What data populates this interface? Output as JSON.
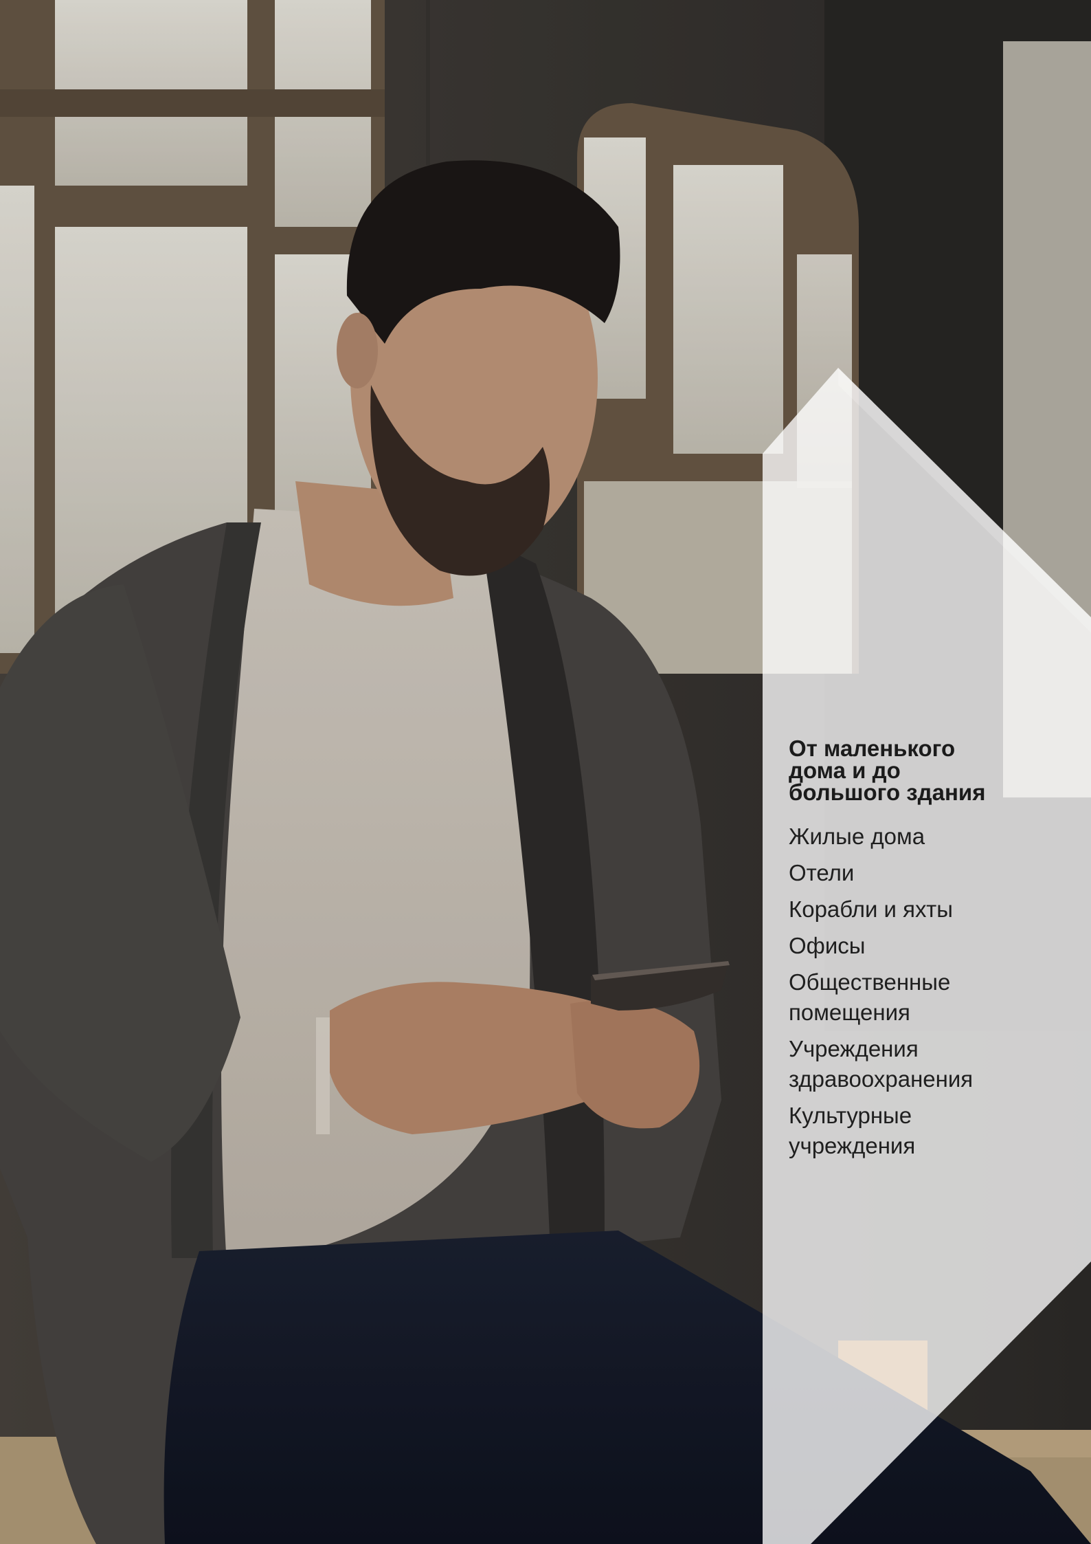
{
  "content": {
    "headline": "От маленького дома и до большого здания",
    "categories": [
      "Жилые дома",
      "Отели",
      "Корабли и яхты",
      "Офисы",
      "Общественные помещения",
      "Учреждения здравоохранения",
      "Культурные учреждения"
    ]
  },
  "colors": {
    "headline": "#1b1b1b",
    "list_text": "#1f1f1f",
    "panel": "#ffffff"
  },
  "photo": {
    "icon": "man-with-smartphone-photo"
  }
}
